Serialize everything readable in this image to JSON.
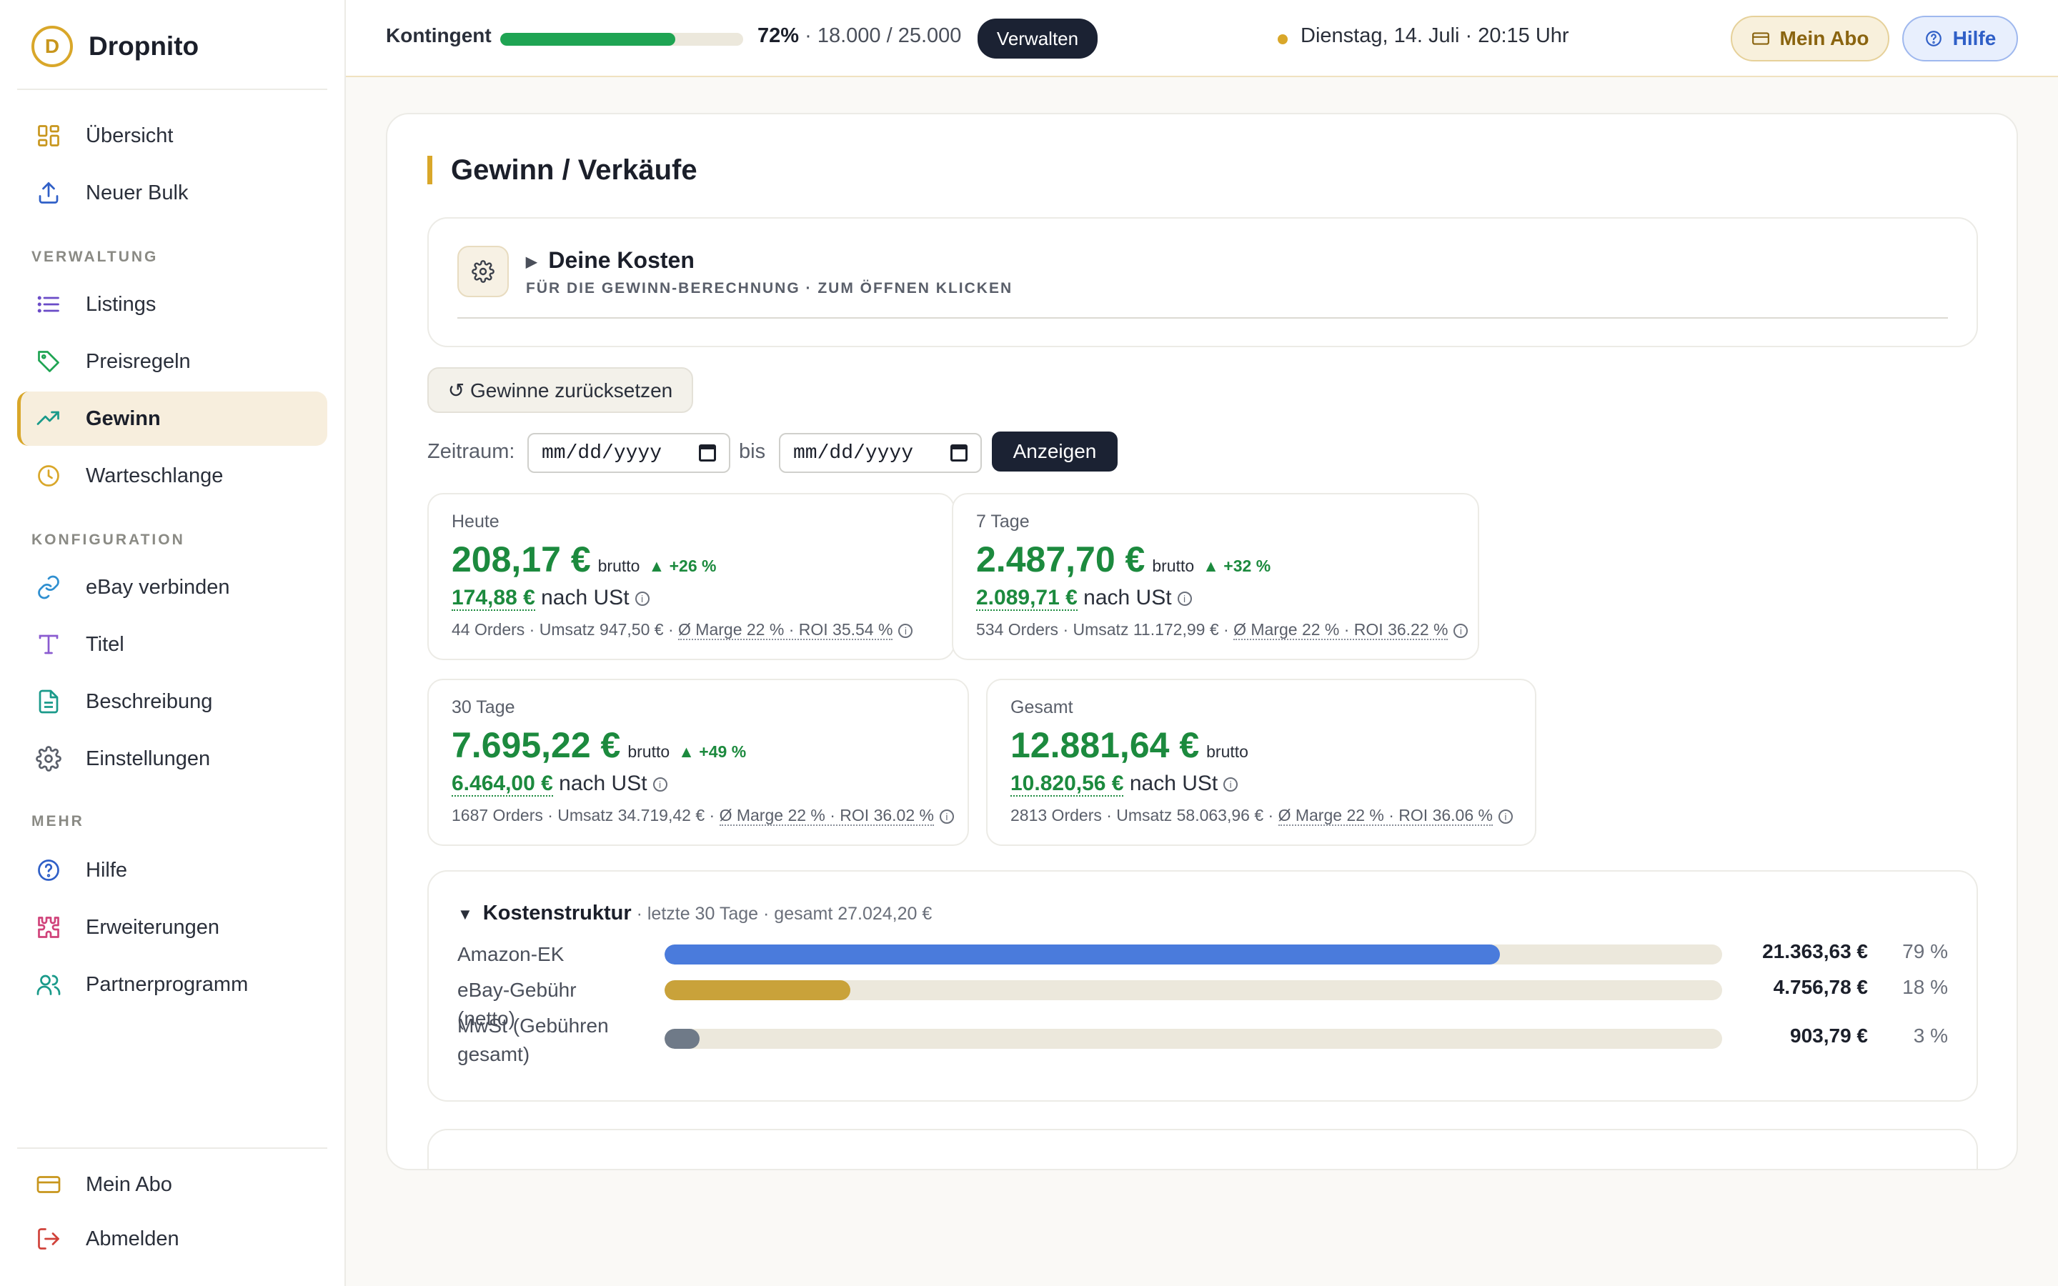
{
  "brand": {
    "name": "Dropnito",
    "logo_letter": "D"
  },
  "sidebar": {
    "top_items": [
      {
        "label": "Übersicht",
        "icon": "grid-icon"
      },
      {
        "label": "Neuer Bulk",
        "icon": "upload-icon"
      }
    ],
    "sections": [
      {
        "title": "VERWALTUNG",
        "items": [
          {
            "label": "Listings",
            "icon": "list-icon"
          },
          {
            "label": "Preisregeln",
            "icon": "tag-icon"
          },
          {
            "label": "Gewinn",
            "icon": "trending-up-icon",
            "active": true
          },
          {
            "label": "Warteschlange",
            "icon": "clock-icon"
          }
        ]
      },
      {
        "title": "KONFIGURATION",
        "items": [
          {
            "label": "eBay verbinden",
            "icon": "link-icon"
          },
          {
            "label": "Titel",
            "icon": "text-icon"
          },
          {
            "label": "Beschreibung",
            "icon": "document-icon"
          },
          {
            "label": "Einstellungen",
            "icon": "gear-icon"
          }
        ]
      },
      {
        "title": "MEHR",
        "items": [
          {
            "label": "Hilfe",
            "icon": "help-circle-icon"
          },
          {
            "label": "Erweiterungen",
            "icon": "puzzle-icon"
          },
          {
            "label": "Partnerprogramm",
            "icon": "users-icon"
          }
        ]
      }
    ],
    "bottom_items": [
      {
        "label": "Mein Abo",
        "icon": "credit-card-icon"
      },
      {
        "label": "Abmelden",
        "icon": "logout-icon"
      }
    ]
  },
  "topbar": {
    "quota_label": "Kontingent",
    "quota_fraction": 0.72,
    "quota_percent": "72%",
    "quota_detail": " · 18.000 / 25.000",
    "manage_label": "Verwalten",
    "datetime": "Dienstag, 14. Juli · 20:15 Uhr",
    "subscription_label": "Mein Abo",
    "help_label": "Hilfe"
  },
  "page": {
    "title": "Gewinn / Verkäufe",
    "costs": {
      "title": "Deine Kosten",
      "subtitle": "FÜR DIE GEWINN-BERECHNUNG · ZUM ÖFFNEN KLICKEN"
    },
    "reset_label": "↺ Gewinne zurücksetzen",
    "range": {
      "label": "Zeitraum:",
      "from_placeholder": "mm/dd/yyyy",
      "to_label": "bis",
      "to_placeholder": "mm/dd/yyyy",
      "submit_label": "Anzeigen"
    },
    "stats": [
      {
        "label": "Heute",
        "gross": "208,17 €",
        "gross_suffix": "brutto",
        "delta": "▲ +26 %",
        "net": "174,88 €",
        "net_suffix": "nach USt",
        "orders": "44 Orders · Umsatz 947,50 € · ",
        "margin": "Ø Marge 22 % · ROI 35.54 %"
      },
      {
        "label": "7 Tage",
        "gross": "2.487,70 €",
        "gross_suffix": "brutto",
        "delta": "▲ +32 %",
        "net": "2.089,71 €",
        "net_suffix": "nach USt",
        "orders": "534 Orders · Umsatz 11.172,99 € · ",
        "margin": "Ø Marge 22 % · ROI 36.22 %"
      },
      {
        "label": "30 Tage",
        "gross": "7.695,22 €",
        "gross_suffix": "brutto",
        "delta": "▲ +49 %",
        "net": "6.464,00 €",
        "net_suffix": "nach USt",
        "orders": "1687 Orders · Umsatz 34.719,42 € · ",
        "margin": "Ø Marge 22 % · ROI 36.02 %"
      },
      {
        "label": "Gesamt",
        "gross": "12.881,64 €",
        "gross_suffix": "brutto",
        "delta": "",
        "net": "10.820,56 €",
        "net_suffix": "nach USt",
        "orders": "2813 Orders · Umsatz 58.063,96 € · ",
        "margin": "Ø Marge 22 % · ROI 36.06 %"
      }
    ],
    "cost_structure": {
      "title": "Kostenstruktur",
      "subtitle": " · letzte 30 Tage · gesamt 27.024,20 €",
      "rows": [
        {
          "name": "Amazon-EK",
          "amount": "21.363,63 €",
          "percent": "79 %",
          "fraction": 0.79,
          "color": "#4a7bdc"
        },
        {
          "name": "eBay-Gebühr (netto)",
          "amount": "4.756,78 €",
          "percent": "18 %",
          "fraction": 0.176,
          "color": "#c9a23a"
        },
        {
          "name": "MwSt (Gebühren gesamt)",
          "amount": "903,79 €",
          "percent": "3 %",
          "fraction": 0.033,
          "color": "#6f7a88"
        }
      ]
    }
  },
  "colors": {
    "accent": "#d9a72a",
    "profit": "#1c8a3e",
    "dark": "#1b2233",
    "help": "#2f5fc7"
  }
}
